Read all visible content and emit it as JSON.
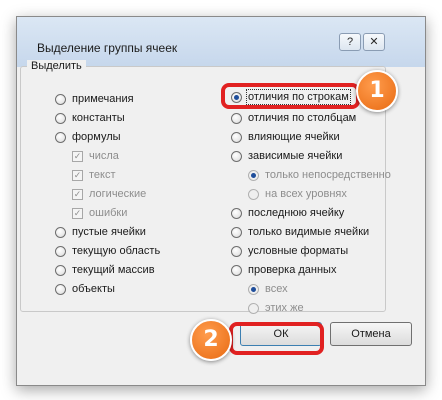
{
  "dialog": {
    "title": "Выделение группы ячеек",
    "help_symbol": "?",
    "close_symbol": "✕"
  },
  "group": {
    "legend": "Выделить"
  },
  "left_options": [
    {
      "label": "примечания",
      "checked": false,
      "type": "radio"
    },
    {
      "label": "константы",
      "checked": false,
      "type": "radio"
    },
    {
      "label": "формулы",
      "checked": false,
      "type": "radio"
    },
    {
      "label": "числа",
      "checked": true,
      "type": "check",
      "disabled": true
    },
    {
      "label": "текст",
      "checked": true,
      "type": "check",
      "disabled": true
    },
    {
      "label": "логические",
      "checked": true,
      "type": "check",
      "disabled": true
    },
    {
      "label": "ошибки",
      "checked": true,
      "type": "check",
      "disabled": true
    },
    {
      "label": "пустые ячейки",
      "checked": false,
      "type": "radio"
    },
    {
      "label": "текущую область",
      "checked": false,
      "type": "radio"
    },
    {
      "label": "текущий массив",
      "checked": false,
      "type": "radio"
    },
    {
      "label": "объекты",
      "checked": false,
      "type": "radio"
    }
  ],
  "right_options": [
    {
      "label": "отличия по строкам",
      "checked": true,
      "type": "radio"
    },
    {
      "label": "отличия по столбцам",
      "checked": false,
      "type": "radio"
    },
    {
      "label": "влияющие ячейки",
      "checked": false,
      "type": "radio"
    },
    {
      "label": "зависимые ячейки",
      "checked": false,
      "type": "radio"
    },
    {
      "label": "только непосредственно",
      "checked": true,
      "type": "radio",
      "disabled": true
    },
    {
      "label": "на всех уровнях",
      "checked": false,
      "type": "radio",
      "disabled": true
    },
    {
      "label": "последнюю ячейку",
      "checked": false,
      "type": "radio"
    },
    {
      "label": "только видимые ячейки",
      "checked": false,
      "type": "radio"
    },
    {
      "label": "условные форматы",
      "checked": false,
      "type": "radio"
    },
    {
      "label": "проверка данных",
      "checked": false,
      "type": "radio"
    },
    {
      "label": "всех",
      "checked": true,
      "type": "radio",
      "disabled": true
    },
    {
      "label": "этих же",
      "checked": false,
      "type": "radio",
      "disabled": true
    }
  ],
  "buttons": {
    "ok": "ОК",
    "cancel": "Отмена"
  },
  "annotations": {
    "badge1": "1",
    "badge2": "2"
  },
  "colors": {
    "highlight": "#e12121",
    "badge": "#f08a2c",
    "accent": "#1f4e9b"
  }
}
